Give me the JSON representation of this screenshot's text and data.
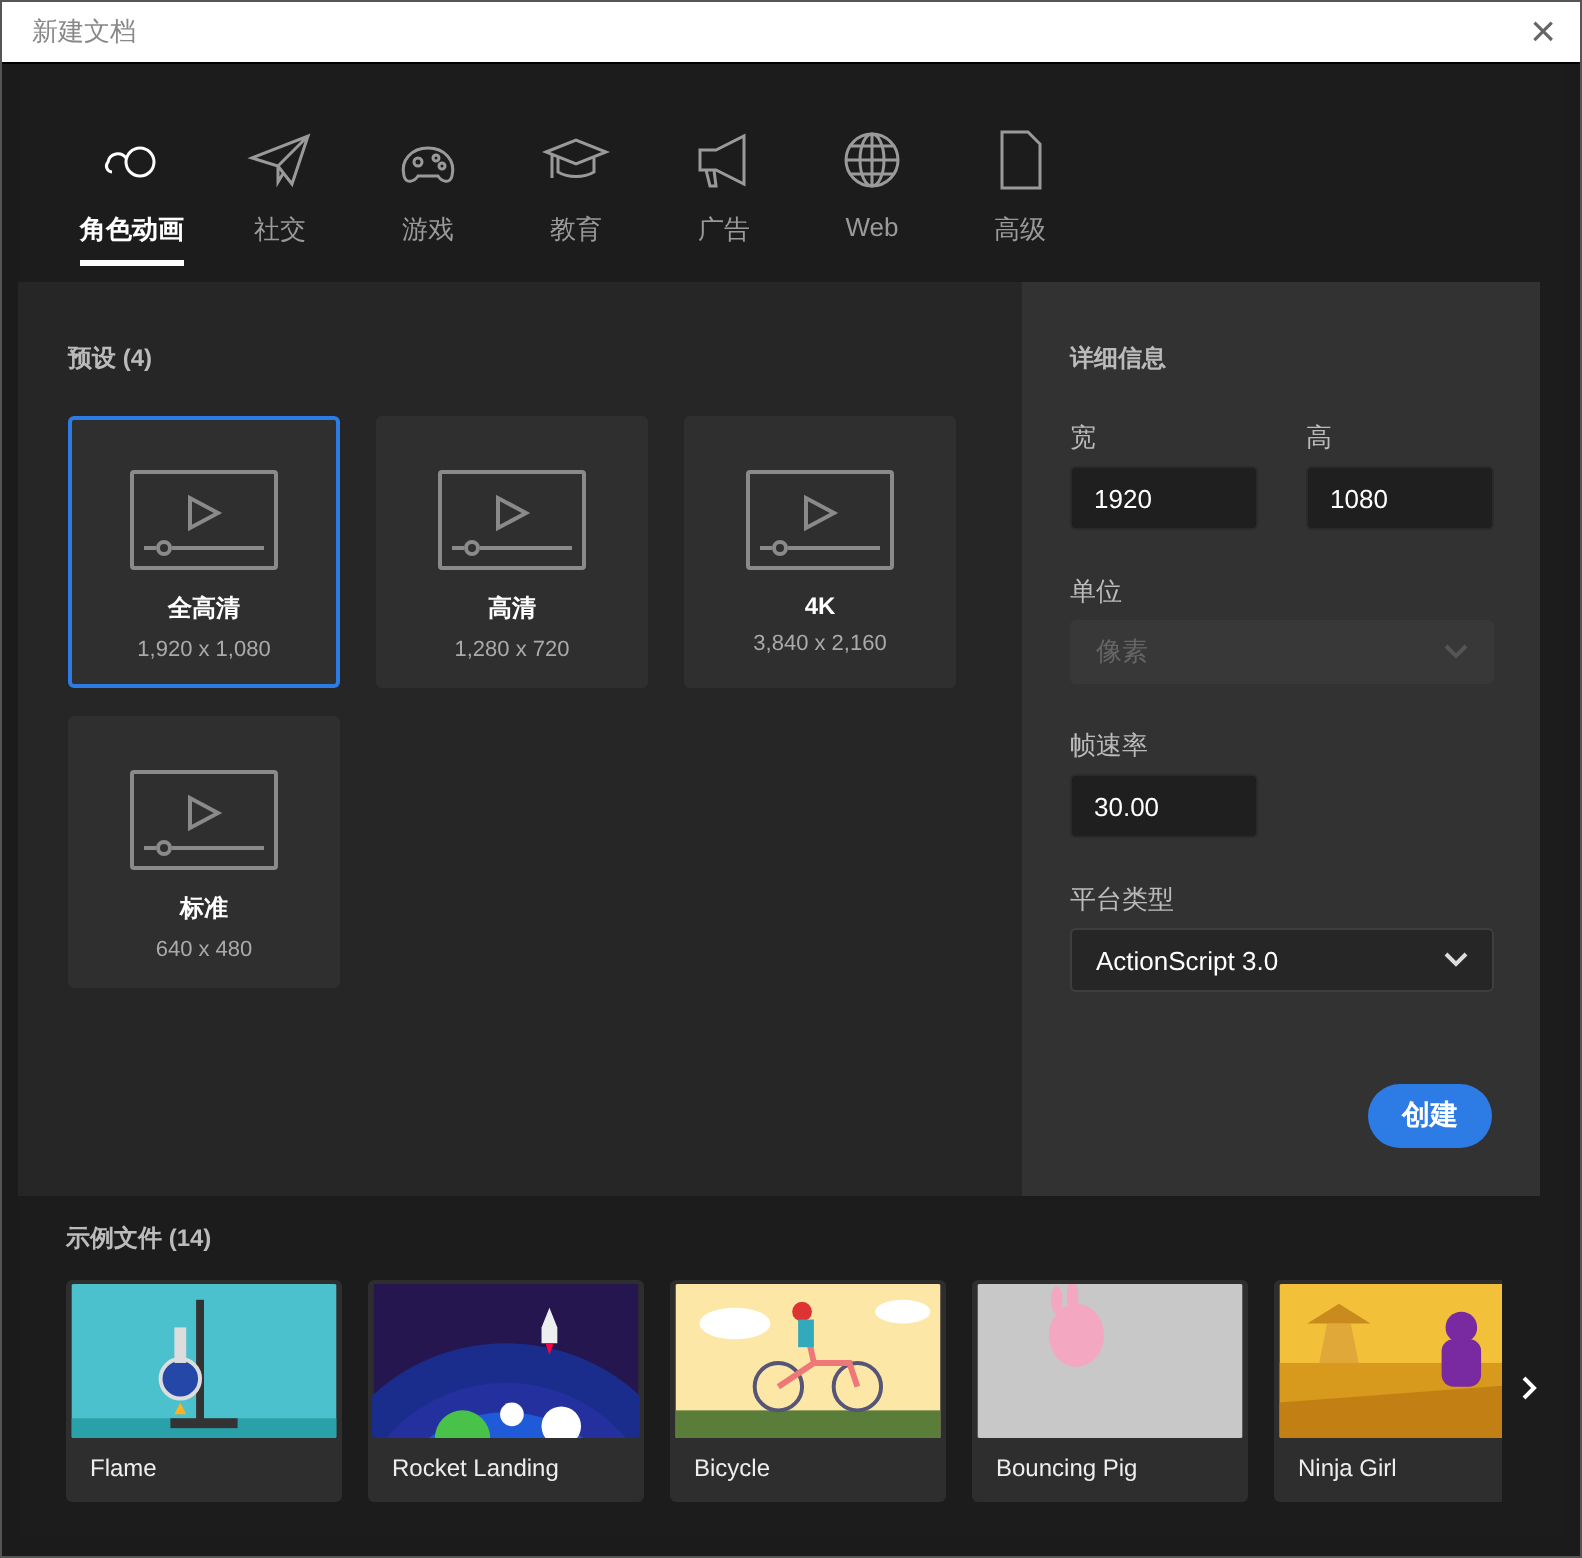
{
  "window": {
    "title": "新建文档",
    "close": "×"
  },
  "tabs": [
    {
      "label": "角色动画",
      "selected": true
    },
    {
      "label": "社交",
      "selected": false
    },
    {
      "label": "游戏",
      "selected": false
    },
    {
      "label": "教育",
      "selected": false
    },
    {
      "label": "广告",
      "selected": false
    },
    {
      "label": "Web",
      "selected": false
    },
    {
      "label": "高级",
      "selected": false
    }
  ],
  "presets": {
    "title": "预设 (4)",
    "items": [
      {
        "name": "全高清",
        "size": "1,920 x 1,080",
        "selected": true
      },
      {
        "name": "高清",
        "size": "1,280 x 720",
        "selected": false
      },
      {
        "name": "4K",
        "size": "3,840 x 2,160",
        "selected": false
      },
      {
        "name": "标准",
        "size": "640 x 480",
        "selected": false
      }
    ]
  },
  "details": {
    "title": "详细信息",
    "size": [
      {
        "label": "宽",
        "value": "1920"
      },
      {
        "label": "高",
        "value": "1080"
      }
    ],
    "unit": {
      "label": "单位",
      "value": "像素",
      "disabled": true
    },
    "frame_rate": {
      "label": "帧速率",
      "value": "30.00"
    },
    "platform": {
      "label": "平台类型",
      "value": "ActionScript 3.0",
      "disabled": false
    },
    "create_button": "创建"
  },
  "samples": {
    "title": "示例文件 (14)",
    "items": [
      {
        "name": "Flame"
      },
      {
        "name": "Rocket Landing"
      },
      {
        "name": "Bicycle"
      },
      {
        "name": "Bouncing Pig"
      },
      {
        "name": "Ninja Girl"
      }
    ]
  }
}
